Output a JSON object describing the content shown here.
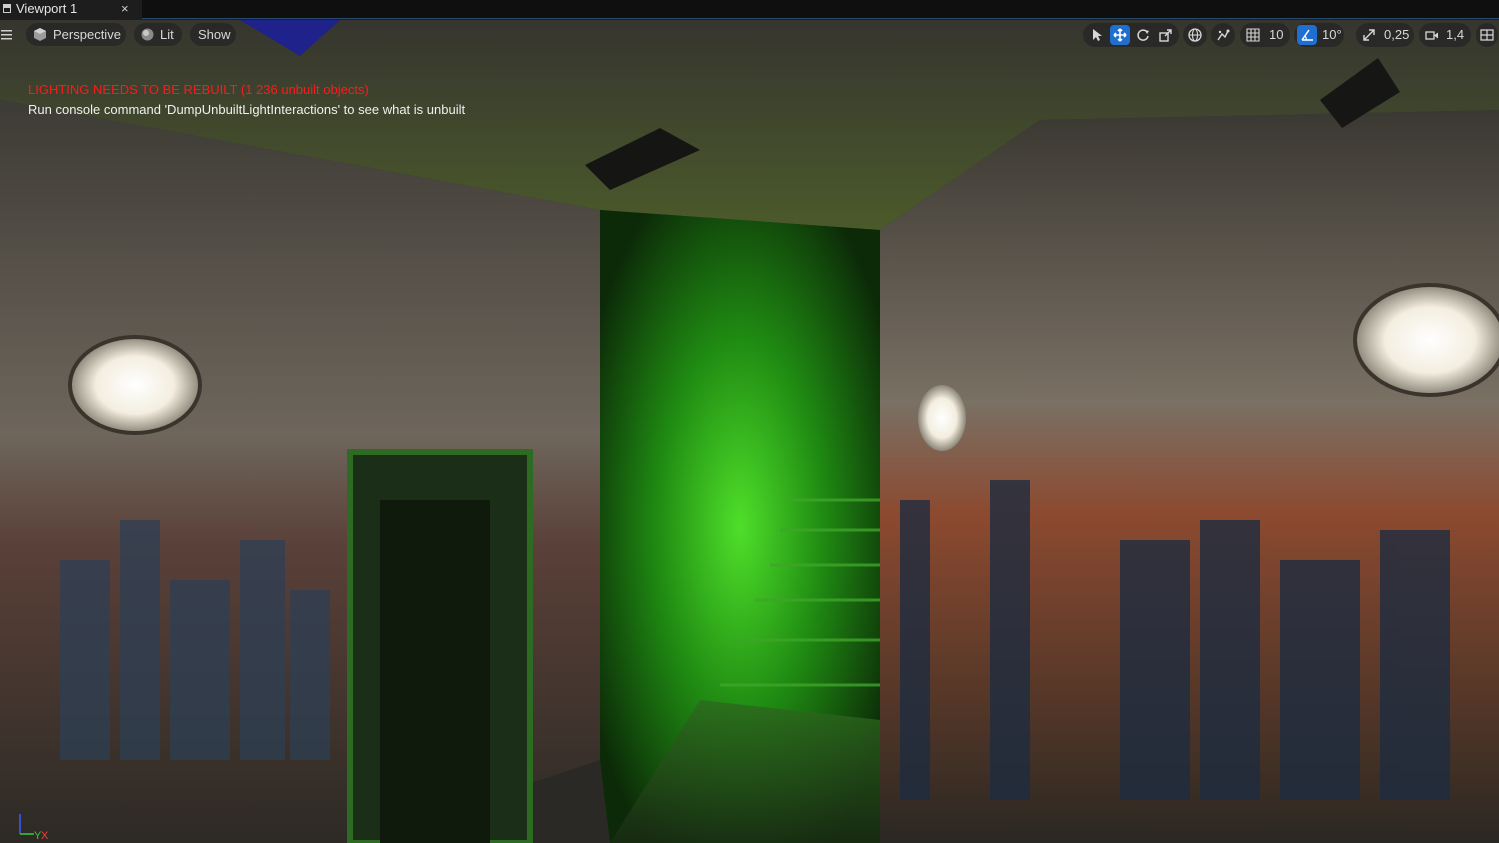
{
  "tab": {
    "title": "Viewport 1",
    "close_glyph": "×"
  },
  "toolbar": {
    "menu_icon": "hamburger-menu-icon",
    "perspective_label": "Perspective",
    "lit_label": "Lit",
    "show_label": "Show",
    "grid_snap_value": "10",
    "rotation_snap_value": "10°",
    "scale_snap_value": "0,25",
    "camera_speed_value": "1,4",
    "active_color": "#1f6fd1",
    "icons": [
      "select-icon",
      "translate-icon",
      "rotate-icon",
      "scale-icon",
      "world-local-icon",
      "surface-snap-icon",
      "grid-snap-icon",
      "angle-snap-icon",
      "scale-snap-icon",
      "camera-speed-icon",
      "viewport-layout-icon"
    ]
  },
  "messages": {
    "lighting_warning": "LIGHTING NEEDS TO BE REBUILT (1 236 unbuilt objects)",
    "console_hint": "Run console command 'DumpUnbuiltLightInteractions' to see what is unbuilt",
    "warning_color": "#ff1a1a"
  },
  "axis_indicator": {
    "label_y": "Y",
    "label_x": "X"
  }
}
